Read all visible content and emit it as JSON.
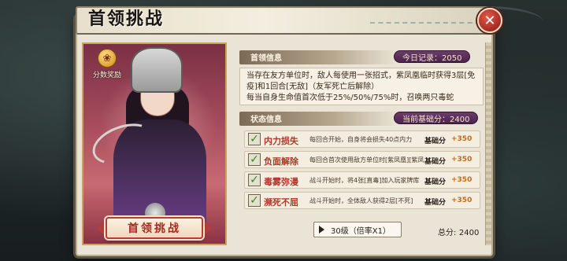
{
  "window": {
    "title": "首领挑战"
  },
  "gift": {
    "label": "分数奖励"
  },
  "challenge_button": {
    "label": "首领挑战"
  },
  "boss_info": {
    "header": "首领信息",
    "record": "今日记录：2050",
    "lines": [
      "当存在友方单位时，敌人每使用一张招式，紫凤凰临时获得3层[免",
      "疫]和1回合[无敌]（友军死亡后解除）",
      "每当自身生命值首次低于25%/50%/75%时，召唤两只毒蛇"
    ]
  },
  "status_info": {
    "header": "状态信息",
    "base_score": "当前基础分：2400",
    "rows": [
      {
        "name": "内力损失",
        "desc": "每回合开始，自身将会损失40点内力",
        "score_label": "基础分",
        "score": "+350",
        "checked": true
      },
      {
        "name": "负面解除",
        "desc": "每回合首次使用敌方单位时[紫凤凰][紫凤凰]消除负面状态",
        "score_label": "基础分",
        "score": "+350",
        "checked": true
      },
      {
        "name": "毒雾弥漫",
        "desc": "战斗开始时，将4张[直毒]加入玩家牌库",
        "score_label": "基础分",
        "score": "+350",
        "checked": true
      },
      {
        "name": "濒死不屈",
        "desc": "战斗开始时，全体敌人获得2层[不死]",
        "score_label": "基础分",
        "score": "+350",
        "checked": true
      }
    ]
  },
  "level_select": {
    "value": "30级（倍率X1）"
  },
  "total": {
    "label": "总分:",
    "value": "2400"
  },
  "colors": {
    "accent": "#b2362a",
    "pill": "#4c234c",
    "score": "#c46a1a"
  }
}
